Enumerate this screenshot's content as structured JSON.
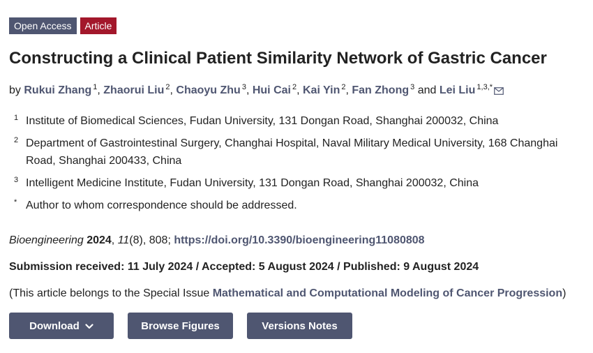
{
  "badges": {
    "open_access": "Open Access",
    "type": "Article"
  },
  "title": "Constructing a Clinical Patient Similarity Network of Gastric Cancer",
  "byline": {
    "prefix": "by",
    "authors": [
      {
        "name": "Rukui Zhang",
        "aff": "1",
        "sep": ", "
      },
      {
        "name": "Zhaorui Liu",
        "aff": "2",
        "sep": ", "
      },
      {
        "name": "Chaoyu Zhu",
        "aff": "3",
        "sep": ", "
      },
      {
        "name": "Hui Cai",
        "aff": "2",
        "sep": ", "
      },
      {
        "name": "Kai Yin",
        "aff": "2",
        "sep": ", "
      },
      {
        "name": "Fan Zhong",
        "aff": "3",
        "sep": " and "
      },
      {
        "name": "Lei Liu",
        "aff": "1,3,*",
        "sep": ""
      }
    ]
  },
  "affiliations": [
    {
      "num": "1",
      "text": "Institute of Biomedical Sciences, Fudan University, 131 Dongan Road, Shanghai 200032, China"
    },
    {
      "num": "2",
      "text": "Department of Gastrointestinal Surgery, Changhai Hospital, Naval Military Medical University, 168 Changhai Road, Shanghai 200433, China"
    },
    {
      "num": "3",
      "text": "Intelligent Medicine Institute, Fudan University, 131 Dongan Road, Shanghai 200032, China"
    },
    {
      "num": "*",
      "text": "Author to whom correspondence should be addressed."
    }
  ],
  "citation": {
    "journal": "Bioengineering",
    "year": "2024",
    "volume": "11",
    "issue_pages": "(8), 808; ",
    "doi": "https://doi.org/10.3390/bioengineering11080808"
  },
  "dates": "Submission received: 11 July 2024 / Accepted: 5 August 2024 / Published: 9 August 2024",
  "special_issue": {
    "prefix": "(This article belongs to the Special Issue ",
    "link": "Mathematical and Computational Modeling of Cancer Progression",
    "suffix": ")"
  },
  "buttons": {
    "download": "Download",
    "figures": "Browse Figures",
    "versions": "Versions Notes"
  },
  "icons": {
    "email": "envelope-icon",
    "download_caret": "chevron-down-icon"
  },
  "colors": {
    "link": "#4f5671",
    "badge_article": "#a3172b",
    "button_bg": "#4f5671"
  }
}
